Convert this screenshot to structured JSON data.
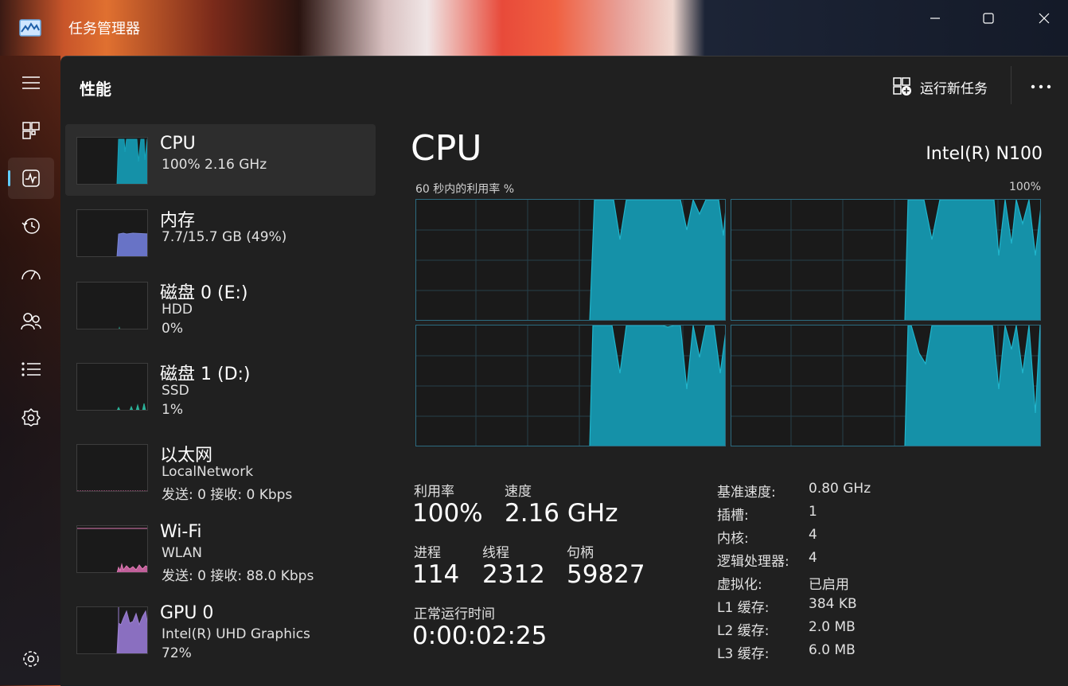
{
  "window": {
    "title": "任务管理器"
  },
  "header": {
    "title": "性能",
    "run_task": "运行新任务"
  },
  "devices": [
    {
      "name": "CPU",
      "line2": "100%  2.16 GHz",
      "line3": "",
      "color": "#17a2b8"
    },
    {
      "name": "内存",
      "line2": "7.7/15.7 GB (49%)",
      "line3": "",
      "color": "#7b86d6"
    },
    {
      "name": "磁盘 0 (E:)",
      "line2": "HDD",
      "line3": "0%",
      "color": "#2bb39a"
    },
    {
      "name": "磁盘 1 (D:)",
      "line2": "SSD",
      "line3": "1%",
      "color": "#2bb39a"
    },
    {
      "name": "以太网",
      "line2": "LocalNetwork",
      "line3": "发送: 0 接收: 0 Kbps",
      "color": "#d06aa0"
    },
    {
      "name": "Wi-Fi",
      "line2": "WLAN",
      "line3": "发送: 0 接收: 88.0 Kbps",
      "color": "#e07ab4"
    },
    {
      "name": "GPU 0",
      "line2": "Intel(R) UHD Graphics",
      "line3": "72%",
      "color": "#9b7fd0"
    }
  ],
  "cpu": {
    "title": "CPU",
    "model": "Intel(R) N100",
    "graph_caption": "60 秒内的利用率 %",
    "graph_max": "100%",
    "stats": {
      "util_label": "利用率",
      "util": "100%",
      "speed_label": "速度",
      "speed": "2.16 GHz",
      "proc_label": "进程",
      "proc": "114",
      "thread_label": "线程",
      "thread": "2312",
      "handle_label": "句柄",
      "handle": "59827",
      "uptime_label": "正常运行时间",
      "uptime": "0:00:02:25"
    },
    "specs": [
      {
        "k": "基准速度:",
        "v": "0.80 GHz"
      },
      {
        "k": "插槽:",
        "v": "1"
      },
      {
        "k": "内核:",
        "v": "4"
      },
      {
        "k": "逻辑处理器:",
        "v": "4"
      },
      {
        "k": "虚拟化:",
        "v": "已启用"
      },
      {
        "k": "L1 缓存:",
        "v": "384 KB"
      },
      {
        "k": "L2 缓存:",
        "v": "2.0 MB"
      },
      {
        "k": "L3 缓存:",
        "v": "6.0 MB"
      }
    ]
  },
  "colors": {
    "accent": "#60cdff",
    "cpu_fill": "#1591a8",
    "cpu_line": "#17a2b8"
  },
  "icons": [
    "task-manager-icon",
    "minimize-icon",
    "maximize-icon",
    "close-icon",
    "hamburger-icon",
    "processes-icon",
    "performance-icon",
    "app-history-icon",
    "startup-icon",
    "users-icon",
    "details-icon",
    "services-icon",
    "settings-icon",
    "run-task-icon",
    "more-icon"
  ]
}
